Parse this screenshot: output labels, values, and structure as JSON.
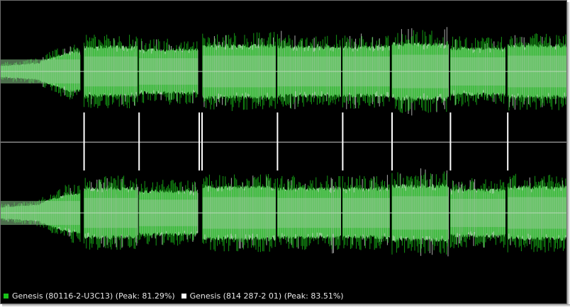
{
  "colors": {
    "background": "#000000",
    "track_a": "#19b319",
    "track_a_fill": "#8ccb8c",
    "track_b": "#ffffff",
    "center_line": "#b8d8b8",
    "divider": "#8a8a8a",
    "marker": "#ffffff"
  },
  "legend": [
    {
      "label": "Genesis (80116-2-U3C13) (Peak: 81.29%)",
      "color": "#19c219",
      "icon": "green-square"
    },
    {
      "label": "Genesis (814 287-2 01) (Peak: 83.51%)",
      "color": "#ffffff",
      "icon": "white-square"
    }
  ],
  "waveform": {
    "channels": [
      "left",
      "right"
    ],
    "segments": [
      {
        "start": 0.0,
        "end": 0.14,
        "level_a": 0.56,
        "level_b": 0.48,
        "shape": "ramp"
      },
      {
        "start": 0.147,
        "end": 0.241,
        "level_a": 0.7,
        "level_b": 0.6
      },
      {
        "start": 0.244,
        "end": 0.348,
        "level_a": 0.62,
        "level_b": 0.55
      },
      {
        "start": 0.356,
        "end": 0.485,
        "level_a": 0.74,
        "level_b": 0.64
      },
      {
        "start": 0.488,
        "end": 0.6,
        "level_a": 0.7,
        "level_b": 0.7
      },
      {
        "start": 0.603,
        "end": 0.686,
        "level_a": 0.7,
        "level_b": 0.66
      },
      {
        "start": 0.69,
        "end": 0.79,
        "level_a": 0.78,
        "level_b": 0.8
      },
      {
        "start": 0.793,
        "end": 0.89,
        "level_a": 0.66,
        "level_b": 0.6
      },
      {
        "start": 0.894,
        "end": 1.0,
        "level_a": 0.74,
        "level_b": 0.66
      }
    ],
    "track_markers": [
      0.147,
      0.244,
      0.35,
      0.355,
      0.488,
      0.603,
      0.69,
      0.793,
      0.894
    ]
  }
}
